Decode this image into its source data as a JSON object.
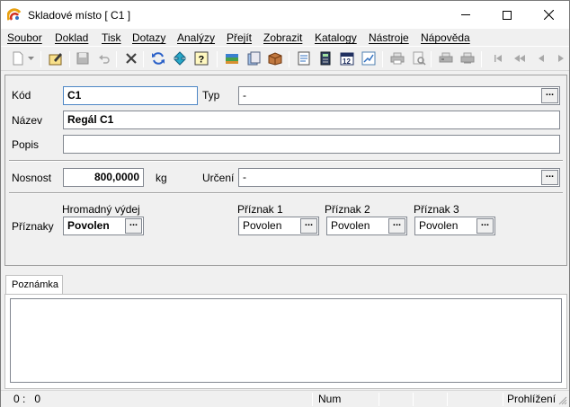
{
  "window": {
    "title": "Skladové místo [ C1 ]",
    "icons": {
      "app": "app-logo-icon",
      "minimize": "minimize-icon",
      "maximize": "maximize-icon",
      "close": "close-icon"
    }
  },
  "menu": [
    "Soubor",
    "Doklad",
    "Tisk",
    "Dotazy",
    "Analýzy",
    "Přejít",
    "Zobrazit",
    "Katalogy",
    "Nástroje",
    "Nápověda"
  ],
  "toolbar": {
    "icons": [
      "new-document-icon",
      "new-dropdown-icon",
      "edit-icon",
      "save-icon",
      "undo-icon",
      "delete-icon",
      "refresh-icon",
      "sort-icon",
      "help-query-icon",
      "books-icon",
      "documents-icon",
      "box-icon",
      "form-icon",
      "calculator-icon",
      "calendar-icon",
      "chart-icon",
      "print-icon",
      "print-preview-icon",
      "print-setup-icon",
      "print-list-icon",
      "first-record-icon",
      "previous-page-icon",
      "previous-record-icon",
      "next-record-icon"
    ]
  },
  "form": {
    "kod_label": "Kód",
    "kod_value": "C1",
    "typ_label": "Typ",
    "typ_value": "-",
    "nazev_label": "Název",
    "nazev_value": "Regál C1",
    "popis_label": "Popis",
    "popis_value": "",
    "nosnost_label": "Nosnost",
    "nosnost_value": "800,0000",
    "nosnost_unit": "kg",
    "urceni_label": "Určení",
    "urceni_value": "-",
    "priznaky_label": "Příznaky",
    "hromadny_label": "Hromadný výdej",
    "hromadny_value": "Povolen",
    "priznak1_label": "Příznak 1",
    "priznak1_value": "Povolen",
    "priznak2_label": "Příznak 2",
    "priznak2_value": "Povolen",
    "priznak3_label": "Příznak 3",
    "priznak3_value": "Povolen",
    "ellipsis": "..."
  },
  "tabs": [
    {
      "label": "Poznámka"
    }
  ],
  "note": {
    "value": ""
  },
  "status": {
    "position": "0 :   0",
    "num": "Num",
    "mode": "Prohlížení"
  }
}
